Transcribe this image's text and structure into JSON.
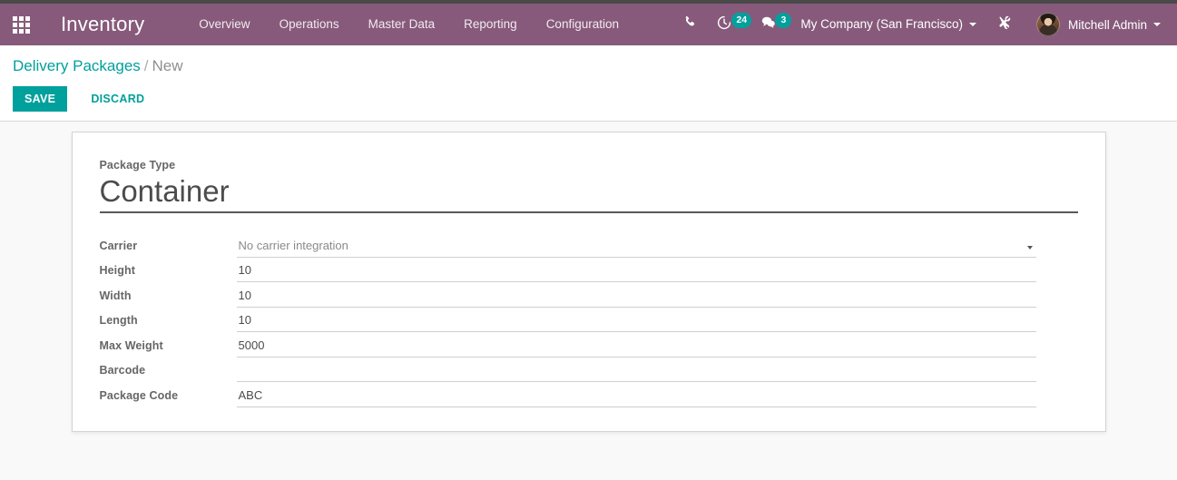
{
  "navbar": {
    "apps_icon": "apps-grid-icon",
    "brand": "Inventory",
    "menu": [
      {
        "label": "Overview"
      },
      {
        "label": "Operations"
      },
      {
        "label": "Master Data"
      },
      {
        "label": "Reporting"
      },
      {
        "label": "Configuration"
      }
    ],
    "phone_icon": "phone-icon",
    "activity": {
      "icon": "clock-activity-icon",
      "count": "24"
    },
    "messages": {
      "icon": "chat-bubble-icon",
      "count": "3"
    },
    "company": "My Company (San Francisco)",
    "tools_icon": "tools-wrench-icon",
    "user": "Mitchell Admin",
    "accent": "#875a7b"
  },
  "control_panel": {
    "breadcrumb": {
      "parent": "Delivery Packages",
      "separator": "/",
      "current": "New"
    },
    "save_label": "SAVE",
    "discard_label": "DISCARD",
    "accent": "#00a09d"
  },
  "form": {
    "title_label": "Package Type",
    "title_value": "Container",
    "fields": [
      {
        "label": "Carrier",
        "value": "No carrier integration",
        "type": "select",
        "muted": true
      },
      {
        "label": "Height",
        "value": "10",
        "type": "text",
        "muted": false
      },
      {
        "label": "Width",
        "value": "10",
        "type": "text",
        "muted": false
      },
      {
        "label": "Length",
        "value": "10",
        "type": "text",
        "muted": false
      },
      {
        "label": "Max Weight",
        "value": "5000",
        "type": "text",
        "muted": false
      },
      {
        "label": "Barcode",
        "value": "",
        "type": "text",
        "muted": false
      },
      {
        "label": "Package Code",
        "value": "ABC",
        "type": "text",
        "muted": false
      }
    ]
  }
}
